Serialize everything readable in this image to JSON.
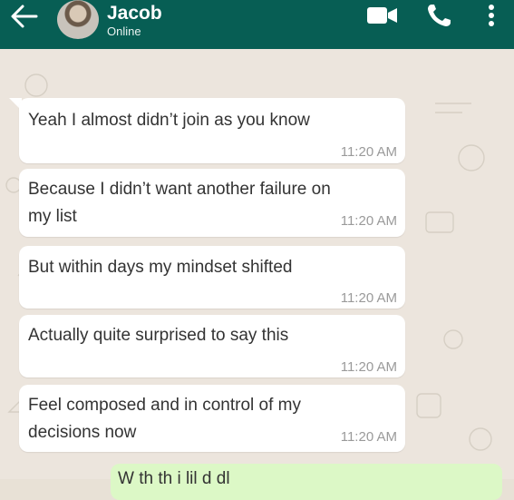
{
  "header": {
    "contact_name": "Jacob",
    "status": "Online",
    "back_icon": "arrow-left-icon",
    "video_icon": "video-camera-icon",
    "call_icon": "phone-icon",
    "menu_icon": "more-vertical-icon",
    "bg_color": "#075e54"
  },
  "messages": [
    {
      "text_lines": [
        "Yeah I almost didn’t join as you know"
      ],
      "time": "11:20 AM",
      "direction": "incoming"
    },
    {
      "text_lines": [
        "Because I didn’t want another failure on",
        "my list"
      ],
      "time": "11:20 AM",
      "direction": "incoming"
    },
    {
      "text_lines": [
        "But within days my mindset shifted"
      ],
      "time": "11:20 AM",
      "direction": "incoming"
    },
    {
      "text_lines": [
        "Actually quite surprised to say this"
      ],
      "time": "11:20 AM",
      "direction": "incoming"
    },
    {
      "text_lines": [
        "Feel composed and in control of my",
        "decisions now"
      ],
      "time": "11:20 AM",
      "direction": "incoming"
    },
    {
      "text_lines": [
        "W         th   th   i       lil    d    dl"
      ],
      "time": "",
      "direction": "outgoing"
    }
  ],
  "colors": {
    "incoming_bubble": "#ffffff",
    "outgoing_bubble": "#dcf8c6",
    "chat_bg": "#ece5dd"
  }
}
